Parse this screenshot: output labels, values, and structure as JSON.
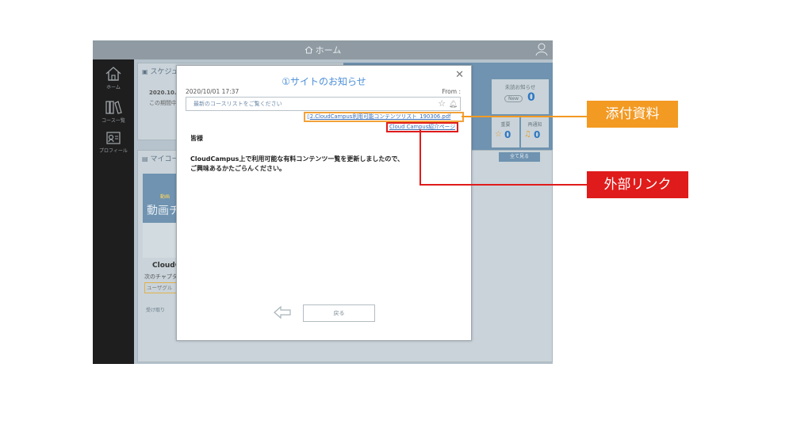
{
  "app": {
    "topbar_title": "ホーム",
    "nav": [
      {
        "label": "ホーム",
        "icon": "home-icon"
      },
      {
        "label": "コース一覧",
        "icon": "books-icon"
      },
      {
        "label": "プロフィール",
        "icon": "profile-icon"
      }
    ],
    "schedule": {
      "title": "スケジュ",
      "date": "2020.10.0",
      "text": "この期間中"
    },
    "mycourse": {
      "title": "マイコー",
      "banner_small": "動画",
      "banner": "動画チ",
      "course_name": "CloudC",
      "next_chapter": "次のチャプタ",
      "user_group": "ユーザグル",
      "footer": "受け取り"
    },
    "stats": {
      "unread_label": "未読お知らせ",
      "unread_badge": "New",
      "unread_count": "0",
      "important_label": "重要",
      "important_count": "0",
      "remind_label": "再通知",
      "remind_count": "0"
    },
    "see_all": "全て見る"
  },
  "modal": {
    "title": "①サイトのお知らせ",
    "date": "2020/10/01 17:37",
    "from_label": "From :",
    "subject": "最新のコースリストをご覧ください",
    "attachment": "2.CloudCampus利用可能コンテンツリスト_190306.pdf",
    "link": "Cloud Campus紹介ページ",
    "greeting": "皆様",
    "body_line1": "CloudCampus上で利用可能な有料コンテンツ一覧を更新しましたので、",
    "body_line2": "ご興味あるかたごらんください。",
    "back_label": "戻る"
  },
  "callouts": {
    "attachment_label": "添付資料",
    "link_label": "外部リンク"
  },
  "colors": {
    "attach_tag": "#f39a22",
    "link_tag": "#e01b1b",
    "title": "#4d8fd8"
  }
}
